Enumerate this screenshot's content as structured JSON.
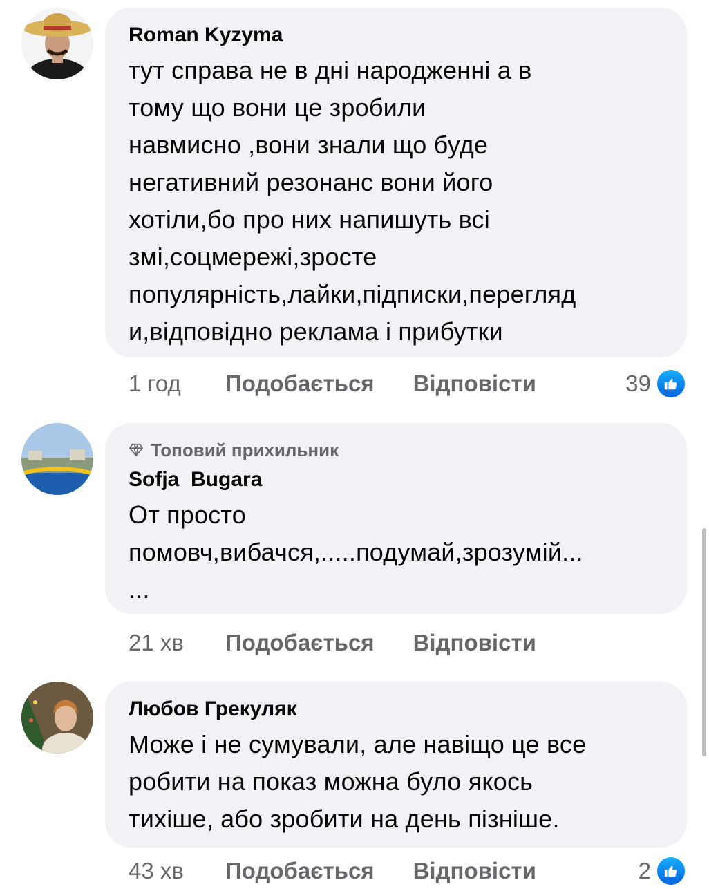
{
  "comments": [
    {
      "author": "Roman Kyzyma",
      "text": "тут справа не в дні народженні а в\nтому що вони це зробили\nнавмисно ,вони знали що буде\nнегативний резонанс вони його\nхотіли,бо про них напишуть всі\nзмі,соцмережі,зросте\nпопулярність,лайки,підписки,перегляд\nи,відповідно реклама і прибутки",
      "time": "1 год",
      "like_label": "Подобається",
      "reply_label": "Відповісти",
      "reaction_count": "39"
    },
    {
      "badge": "Топовий прихильник",
      "author": "Sofja  Bugara",
      "text": "От просто\nпомовч,вибачся,.....подумай,зрозумій...\n...",
      "time": "21 хв",
      "like_label": "Подобається",
      "reply_label": "Відповісти"
    },
    {
      "author": "Любов Грекуляк",
      "text": "Може і не сумували, але навіщо це все\nробити на показ можна було якось\nтихіше, або зробити на день пізніше.",
      "time": "43 хв",
      "like_label": "Подобається",
      "reply_label": "Відповісти",
      "reaction_count": "2"
    }
  ],
  "icons": {
    "badge": "diamond-icon",
    "reaction": "like-thumb-icon"
  },
  "colors": {
    "bubble": "#f0f2f5",
    "meta_text": "#65676b",
    "like_blue": "#0866ff"
  }
}
